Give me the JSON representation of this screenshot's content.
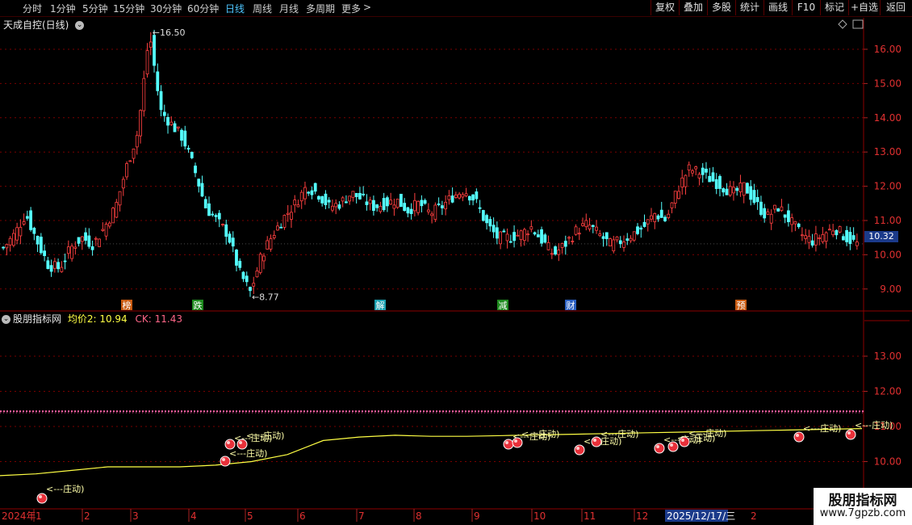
{
  "toolbar": {
    "periods": [
      "分时",
      "1分钟",
      "5分钟",
      "15分钟",
      "30分钟",
      "60分钟",
      "日线",
      "周线",
      "月线",
      "多周期",
      "更多"
    ],
    "active_period": "日线",
    "more_arrow": ">",
    "right_buttons": [
      "复权",
      "叠加",
      "多股",
      "统计",
      "画线",
      "F10",
      "标记",
      "+自选",
      "返回"
    ]
  },
  "main": {
    "title": "天成自控(日线)",
    "y_ticks": [
      "16.00",
      "15.00",
      "14.00",
      "13.00",
      "12.00",
      "11.00",
      "10.00",
      "9.00"
    ],
    "current_price": "10.32",
    "high_label": "16.50",
    "low_label": "8.77",
    "markers": [
      "榜",
      "跌",
      "解",
      "减",
      "财",
      "预"
    ]
  },
  "indicator": {
    "title": "股朋指标网",
    "avg_label": "均价2: 10.94",
    "ck_label": "CK: 11.43",
    "y_ticks": [
      "13.00",
      "12.00",
      "11.00",
      "10.00"
    ],
    "signal_text": "<---庄动)"
  },
  "xaxis": {
    "year_label": "2024年",
    "months": [
      "1",
      "2",
      "3",
      "4",
      "5",
      "6",
      "7",
      "8",
      "9",
      "10",
      "11",
      "12"
    ],
    "date_highlight": "2025/12/17/三",
    "tail_month": "2"
  },
  "watermark": {
    "title": "股朋指标网",
    "url": "www.7gpzb.com"
  },
  "colors": {
    "background": "#000000",
    "up_candle": "#ff4040",
    "down_candle": "#54ffff",
    "avg_line": "#ffff44",
    "ck_line": "#ff66aa",
    "active_tab": "#4ec6ff",
    "current_price_box": "#1b3a8a"
  },
  "chart_data": {
    "type": "candlestick",
    "title": "天成自控(日线)",
    "ylim": [
      8.6,
      16.8
    ],
    "y_ticks": [
      16,
      15,
      14,
      13,
      12,
      11,
      10,
      9
    ],
    "high": 16.5,
    "low": 8.77,
    "last_close": 10.32,
    "approx_close_path": [
      10.2,
      10.6,
      11.2,
      10.4,
      9.7,
      9.6,
      10.2,
      10.5,
      10.3,
      10.8,
      11.4,
      12.6,
      13.6,
      16.5,
      14.2,
      13.8,
      13.4,
      12.5,
      11.4,
      11.0,
      10.6,
      9.5,
      8.9,
      10.0,
      10.6,
      11.1,
      11.5,
      12.0,
      11.8,
      11.4,
      11.5,
      11.8,
      11.6,
      11.4,
      11.5,
      11.6,
      11.3,
      11.5,
      11.2,
      11.4,
      11.7,
      11.9,
      11.6,
      10.9,
      10.5,
      10.5,
      10.6,
      10.8,
      10.4,
      10.0,
      10.3,
      10.7,
      10.9,
      10.6,
      10.3,
      10.4,
      10.6,
      10.8,
      11.2,
      11.0,
      11.9,
      12.5,
      12.4,
      12.2,
      12.0,
      11.8,
      12.0,
      11.5,
      11.1,
      11.4,
      11.0,
      10.6,
      10.4,
      10.6,
      10.8,
      10.5,
      10.32
    ],
    "indicator": {
      "name": "股朋指标网",
      "series": [
        {
          "name": "均价2",
          "last": 10.94,
          "values": [
            9.6,
            9.65,
            9.75,
            9.85,
            9.85,
            9.85,
            9.9,
            10.0,
            10.2,
            10.6,
            10.7,
            10.75,
            10.72,
            10.72,
            10.74,
            10.76,
            10.78,
            10.8,
            10.82,
            10.84,
            10.86,
            10.88,
            10.9,
            10.92,
            10.94
          ]
        },
        {
          "name": "CK",
          "last": 11.43
        }
      ],
      "ylim": [
        9.1,
        14.2
      ],
      "y_ticks": [
        13,
        12,
        11,
        10
      ]
    }
  }
}
